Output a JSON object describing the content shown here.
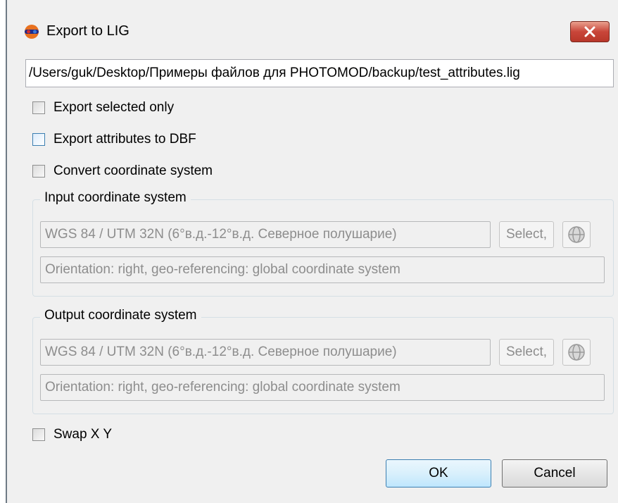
{
  "window": {
    "title": "Export to LIG",
    "icon": "globe-3d-glasses-icon",
    "close_icon": "close-icon"
  },
  "file_path": "/Users/guk/Desktop/Примеры файлов для PHOTOMOD/backup/test_attributes.lig",
  "options": {
    "export_selected_only": {
      "label": "Export selected only",
      "checked": false
    },
    "export_attributes_dbf": {
      "label": "Export attributes to DBF",
      "checked": false
    },
    "convert_coordinate_system": {
      "label": "Convert coordinate system",
      "checked": false
    },
    "swap_xy": {
      "label": "Swap X Y",
      "checked": false
    }
  },
  "input_cs": {
    "title": "Input coordinate system",
    "name": "WGS 84 / UTM 32N (6°в.д.-12°в.д. Северное полушарие)",
    "select_label": "Select,",
    "orientation": "Orientation: right, geo-referencing: global coordinate system"
  },
  "output_cs": {
    "title": "Output coordinate system",
    "name": "WGS 84 / UTM 32N (6°в.д.-12°в.д. Северное полушарие)",
    "select_label": "Select,",
    "orientation": "Orientation: right, geo-referencing: global coordinate system"
  },
  "buttons": {
    "ok": "OK",
    "cancel": "Cancel"
  },
  "colors": {
    "dialog_bg": "#f0f0f0",
    "close_red": "#c9463a",
    "disabled_text": "#8d8d8d"
  }
}
